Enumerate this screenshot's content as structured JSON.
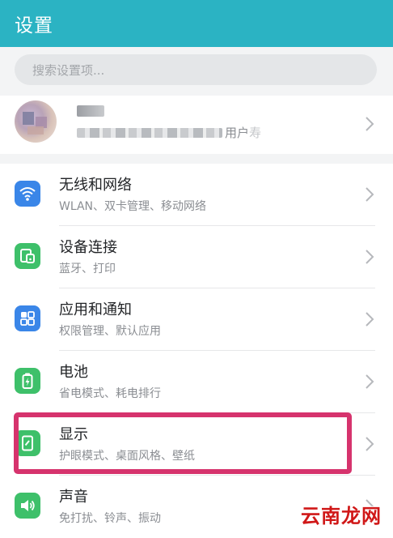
{
  "header": {
    "title": "设置"
  },
  "search": {
    "placeholder": "搜索设置项..."
  },
  "account": {
    "subtitle_visible_fragment": "用户",
    "subtitle_blurred_suffix": "寿"
  },
  "menu": [
    {
      "title": "无线和网络",
      "subtitle": "WLAN、双卡管理、移动网络",
      "icon": "wifi-icon",
      "color": "#3a86e8"
    },
    {
      "title": "设备连接",
      "subtitle": "蓝牙、打印",
      "icon": "device-connection-icon",
      "color": "#3ec06a"
    },
    {
      "title": "应用和通知",
      "subtitle": "权限管理、默认应用",
      "icon": "apps-grid-icon",
      "color": "#3a86e8"
    },
    {
      "title": "电池",
      "subtitle": "省电模式、耗电排行",
      "icon": "battery-icon",
      "color": "#3ec06a"
    },
    {
      "title": "显示",
      "subtitle": "护眼模式、桌面风格、壁纸",
      "icon": "display-icon",
      "color": "#3ec06a"
    },
    {
      "title": "声音",
      "subtitle": "免打扰、铃声、振动",
      "icon": "speaker-icon",
      "color": "#3ec06a"
    }
  ],
  "colors": {
    "header": "#2bb3c3",
    "highlight": "#d6336d",
    "watermark": "#d01818"
  },
  "watermark": {
    "text": "云南龙网"
  }
}
